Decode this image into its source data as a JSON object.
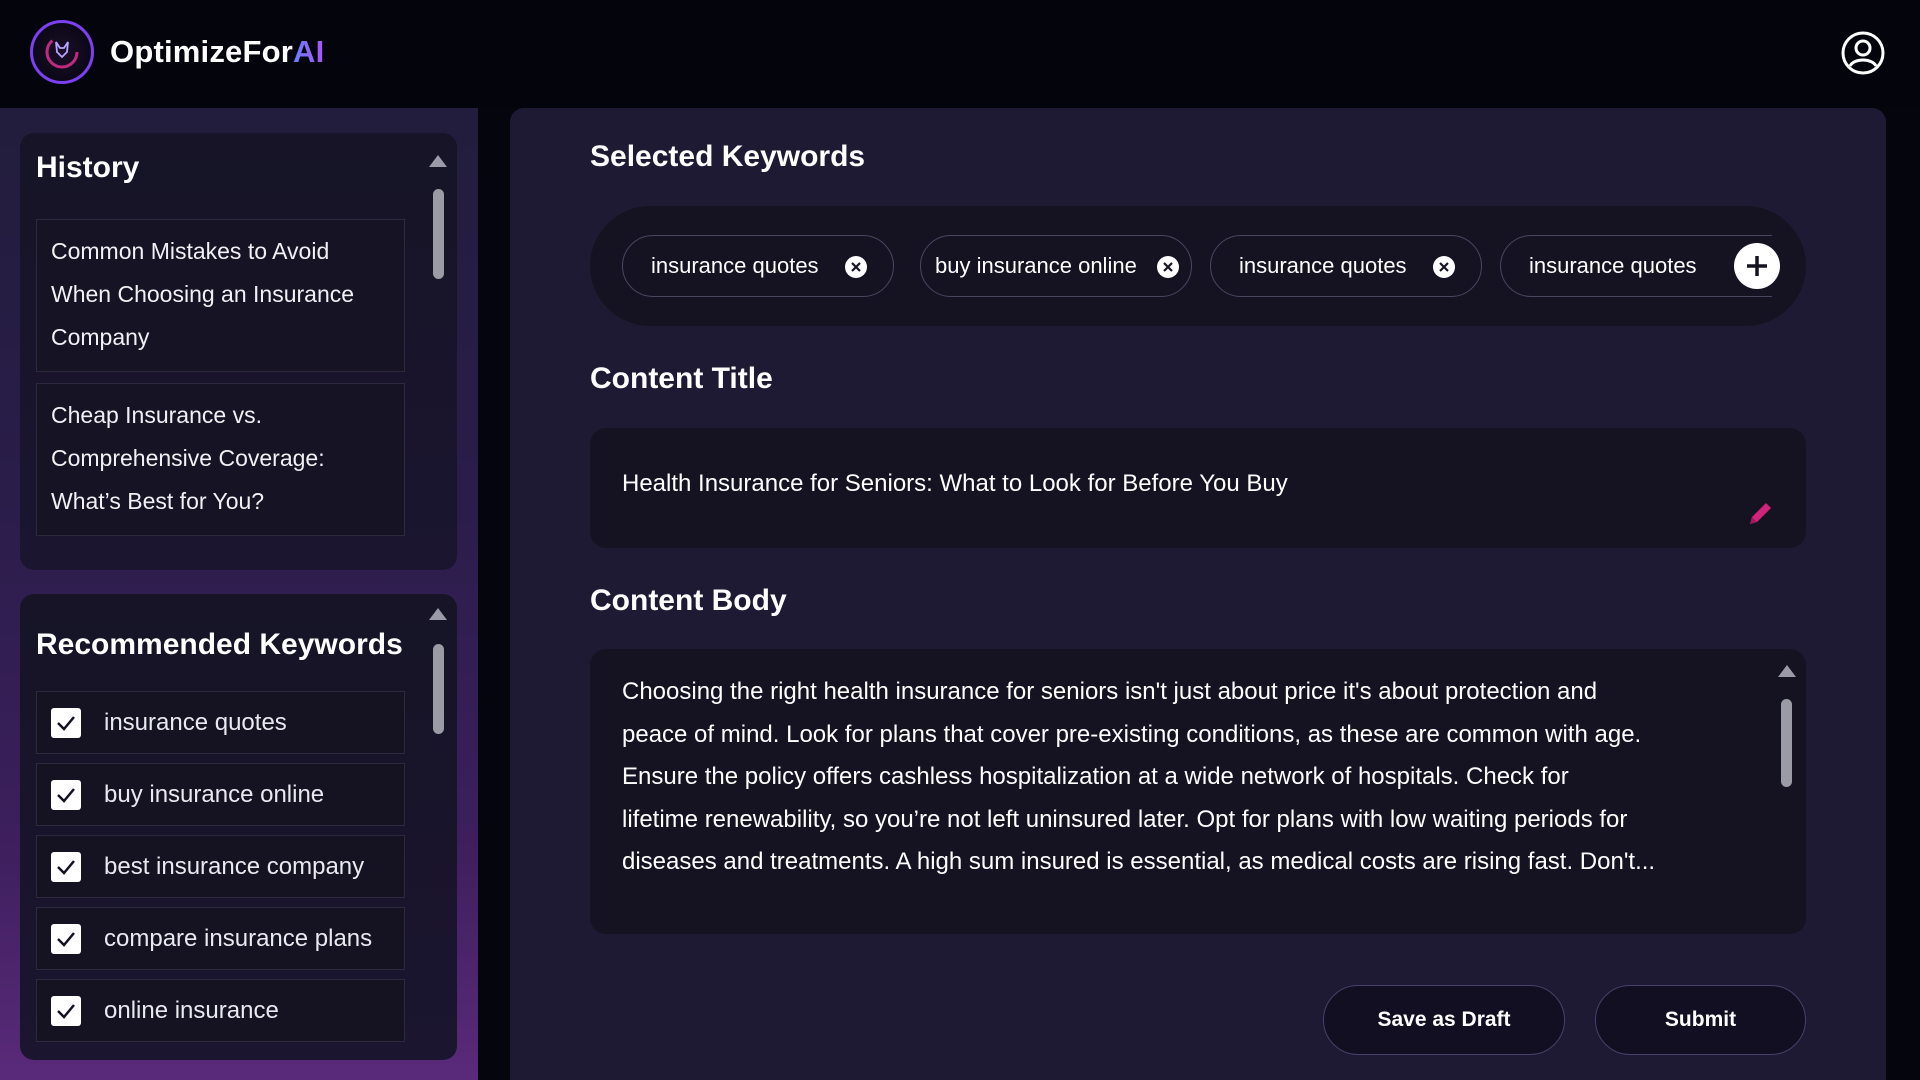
{
  "app": {
    "brand_prefix": "OptimizeFor",
    "brand_suffix": "AI"
  },
  "history": {
    "title": "History",
    "items": [
      {
        "line1": "Common Mistakes to Avoid",
        "line2": "When Choosing an Insurance",
        "line3": "Company"
      },
      {
        "line1": "Cheap Insurance vs.",
        "line2": "Comprehensive Coverage:",
        "line3": "What’s Best for You?"
      }
    ]
  },
  "recommended": {
    "title": "Recommended Keywords",
    "items": [
      {
        "label": "insurance quotes",
        "checked": true
      },
      {
        "label": "buy insurance online",
        "checked": true
      },
      {
        "label": "best insurance company",
        "checked": true
      },
      {
        "label": "compare insurance plans",
        "checked": true
      },
      {
        "label": "online insurance",
        "checked": true
      }
    ]
  },
  "selected_keywords": {
    "title": "Selected Keywords",
    "chips": [
      {
        "label": "insurance quotes"
      },
      {
        "label": "buy insurance online"
      },
      {
        "label": "insurance quotes"
      },
      {
        "label": "insurance quotes"
      }
    ]
  },
  "content_title": {
    "heading": "Content Title",
    "value": "Health Insurance for Seniors: What to Look for Before You Buy"
  },
  "content_body": {
    "heading": "Content Body",
    "lines": [
      "Choosing the right health insurance for seniors isn't just about price it's about protection and",
      "peace of mind. Look for plans that cover pre-existing conditions, as these are common with age.",
      "Ensure the policy offers cashless hospitalization at a wide network of hospitals. Check for",
      "lifetime renewability, so you’re not left uninsured later. Opt for plans with low waiting periods for",
      "diseases and treatments. A high sum insured is essential, as medical costs are rising fast. Don't..."
    ]
  },
  "actions": {
    "save_draft": "Save as Draft",
    "submit": "Submit"
  },
  "icons": {
    "logo": "fox-logo-icon",
    "user": "user-circle-icon",
    "chip_remove": "close-circle-icon",
    "add": "plus-circle-icon",
    "edit": "pencil-icon",
    "check": "check-icon"
  },
  "colors": {
    "background": "#05060d",
    "panel": "#1f1a33",
    "input": "#151322",
    "accent_purple": "#8b5cf6",
    "pencil_pink": "#d0247a"
  }
}
